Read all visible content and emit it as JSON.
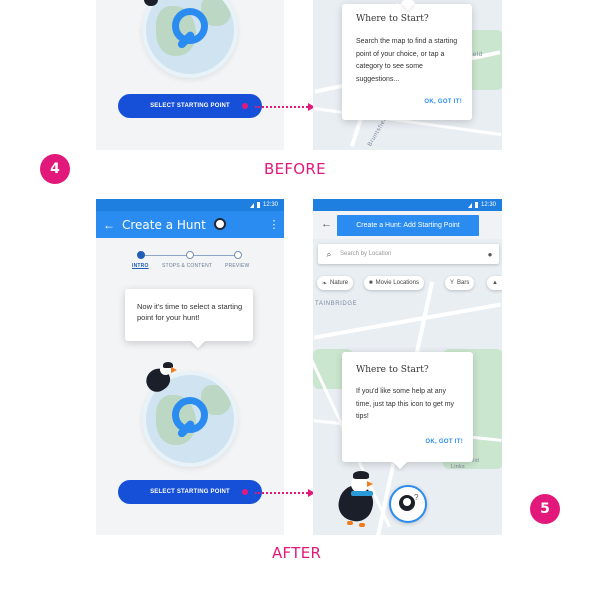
{
  "steps": {
    "four": "4",
    "five": "5"
  },
  "labels": {
    "before": "BEFORE",
    "after": "AFTER"
  },
  "before": {
    "start_button": "SELECT STARTING POINT",
    "map_card": {
      "title": "Where to Start?",
      "body": "Search the map to find a starting point of your choice, or tap a category to see some suggestions...",
      "ok": "OK, GOT IT!"
    },
    "map_label_field": "ield",
    "map_label_road": "Bruntsfield"
  },
  "after": {
    "status_time": "12:30",
    "appbar_title": "Create a Hunt",
    "stepper": [
      "INTRO",
      "STOPS & CONTENT",
      "PREVIEW"
    ],
    "intro_bubble": "Now it's time to select a starting point for your hunt!",
    "start_button": "SELECT STARTING POINT",
    "map_appbar_title": "Create a Hunt: Add Starting Point",
    "search_placeholder": "Search by Location",
    "chips": [
      "Nature",
      "Movie Locations",
      "Bars"
    ],
    "map_label_area": "TAINBRIDGE",
    "map_label_links": "Bruntsfield Links",
    "map_card": {
      "title": "Where to Start?",
      "body": "If you'd like some help at any time, just tap this icon to get my tips!",
      "ok": "OK, GOT IT!"
    }
  },
  "colors": {
    "accent": "#e2197b",
    "primary": "#2a8cf0",
    "button": "#1650d8"
  }
}
